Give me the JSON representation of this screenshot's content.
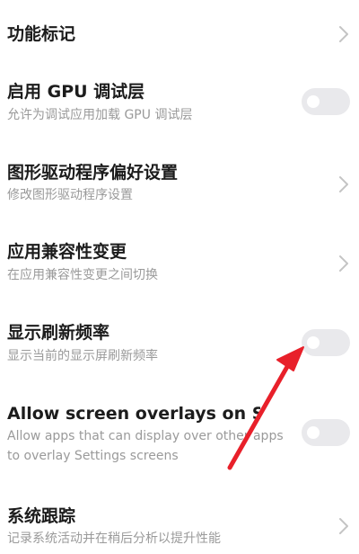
{
  "settings": [
    {
      "title": "功能标记",
      "control": "chevron"
    },
    {
      "title": "启用 GPU 调试层",
      "subtitle": "允许为调试应用加载 GPU 调试层",
      "control": "toggle",
      "toggle_on": false
    },
    {
      "title": "图形驱动程序偏好设置",
      "subtitle": "修改图形驱动程序设置",
      "control": "chevron"
    },
    {
      "title": "应用兼容性变更",
      "subtitle": "在应用兼容性变更之间切换",
      "control": "chevron"
    },
    {
      "title": "显示刷新频率",
      "subtitle": "显示当前的显示屏刷新频率",
      "control": "toggle",
      "toggle_on": false
    },
    {
      "title": "Allow screen overlays on Settings",
      "subtitle": "Allow apps that can display over other apps to overlay Settings screens",
      "control": "toggle",
      "toggle_on": false
    },
    {
      "title": "系统跟踪",
      "subtitle": "记录系统活动并在稍后分析以提升性能",
      "control": "chevron"
    }
  ],
  "colors": {
    "title": "#1c1c1c",
    "subtitle": "#9a9a9a",
    "toggle_track": "#e9e9ec",
    "annotation_arrow": "#e8202a"
  }
}
